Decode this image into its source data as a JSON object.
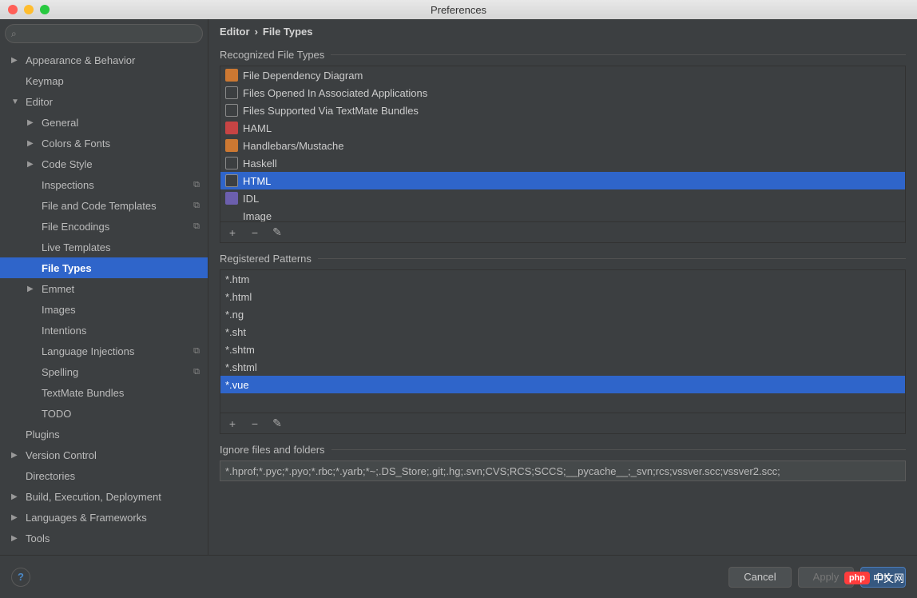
{
  "window": {
    "title": "Preferences"
  },
  "search": {
    "placeholder": ""
  },
  "breadcrumb": {
    "parent": "Editor",
    "sep": "›",
    "current": "File Types"
  },
  "sidebar": {
    "items": [
      {
        "label": "Appearance & Behavior",
        "expandable": true,
        "expanded": false,
        "indent": 0
      },
      {
        "label": "Keymap",
        "expandable": false,
        "indent": 0
      },
      {
        "label": "Editor",
        "expandable": true,
        "expanded": true,
        "indent": 0
      },
      {
        "label": "General",
        "expandable": true,
        "expanded": false,
        "indent": 1
      },
      {
        "label": "Colors & Fonts",
        "expandable": true,
        "expanded": false,
        "indent": 1
      },
      {
        "label": "Code Style",
        "expandable": true,
        "expanded": false,
        "indent": 1
      },
      {
        "label": "Inspections",
        "expandable": false,
        "indent": 1,
        "folderIcon": true
      },
      {
        "label": "File and Code Templates",
        "expandable": false,
        "indent": 1,
        "folderIcon": true
      },
      {
        "label": "File Encodings",
        "expandable": false,
        "indent": 1,
        "folderIcon": true
      },
      {
        "label": "Live Templates",
        "expandable": false,
        "indent": 1
      },
      {
        "label": "File Types",
        "expandable": false,
        "indent": 1,
        "selected": true
      },
      {
        "label": "Emmet",
        "expandable": true,
        "expanded": false,
        "indent": 1
      },
      {
        "label": "Images",
        "expandable": false,
        "indent": 1
      },
      {
        "label": "Intentions",
        "expandable": false,
        "indent": 1
      },
      {
        "label": "Language Injections",
        "expandable": false,
        "indent": 1,
        "folderIcon": true
      },
      {
        "label": "Spelling",
        "expandable": false,
        "indent": 1,
        "folderIcon": true
      },
      {
        "label": "TextMate Bundles",
        "expandable": false,
        "indent": 1
      },
      {
        "label": "TODO",
        "expandable": false,
        "indent": 1
      },
      {
        "label": "Plugins",
        "expandable": false,
        "indent": 0
      },
      {
        "label": "Version Control",
        "expandable": true,
        "expanded": false,
        "indent": 0
      },
      {
        "label": "Directories",
        "expandable": false,
        "indent": 0
      },
      {
        "label": "Build, Execution, Deployment",
        "expandable": true,
        "expanded": false,
        "indent": 0
      },
      {
        "label": "Languages & Frameworks",
        "expandable": true,
        "expanded": false,
        "indent": 0
      },
      {
        "label": "Tools",
        "expandable": true,
        "expanded": false,
        "indent": 0
      }
    ]
  },
  "sections": {
    "recognized": "Recognized File Types",
    "patterns": "Registered Patterns",
    "ignore": "Ignore files and folders"
  },
  "fileTypes": [
    {
      "label": "File Dependency Diagram",
      "iconClass": "orange"
    },
    {
      "label": "Files Opened In Associated Applications",
      "iconClass": "file"
    },
    {
      "label": "Files Supported Via TextMate Bundles",
      "iconClass": "file"
    },
    {
      "label": "HAML",
      "iconClass": "red"
    },
    {
      "label": "Handlebars/Mustache",
      "iconClass": "orange"
    },
    {
      "label": "Haskell",
      "iconClass": "file"
    },
    {
      "label": "HTML",
      "iconClass": "file",
      "selected": true
    },
    {
      "label": "IDL",
      "iconClass": "purple"
    },
    {
      "label": "Image",
      "iconClass": "green"
    }
  ],
  "patterns": [
    {
      "label": "*.htm"
    },
    {
      "label": "*.html"
    },
    {
      "label": "*.ng"
    },
    {
      "label": "*.sht"
    },
    {
      "label": "*.shtm"
    },
    {
      "label": "*.shtml"
    },
    {
      "label": "*.vue",
      "selected": true
    }
  ],
  "ignore": {
    "value": "*.hprof;*.pyc;*.pyo;*.rbc;*.yarb;*~;.DS_Store;.git;.hg;.svn;CVS;RCS;SCCS;__pycache__;_svn;rcs;vssver.scc;vssver2.scc;"
  },
  "buttons": {
    "cancel": "Cancel",
    "apply": "Apply",
    "ok": "OK"
  },
  "watermark": {
    "badge": "php",
    "text": "中文网"
  }
}
